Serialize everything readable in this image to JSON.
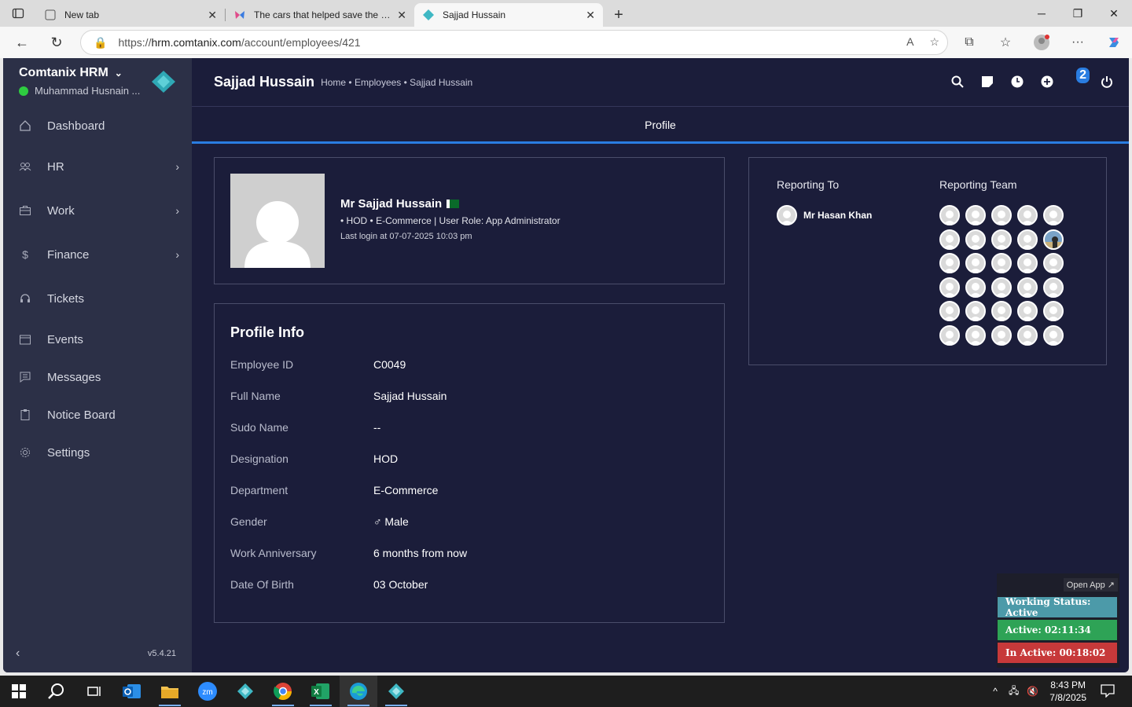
{
  "browser": {
    "tabs": [
      {
        "title": "New tab",
        "active": false
      },
      {
        "title": "The cars that helped save the con",
        "active": false
      },
      {
        "title": "Sajjad Hussain",
        "active": true
      }
    ],
    "url_prefix": "https://",
    "url_host": "hrm.comtanix.com",
    "url_path": "/account/employees/421"
  },
  "sidebar": {
    "brand": "Comtanix HRM",
    "user": "Muhammad Husnain ...",
    "items": [
      {
        "label": "Dashboard",
        "icon": "home-icon",
        "chevron": false
      },
      {
        "label": "HR",
        "icon": "users-icon",
        "chevron": true
      },
      {
        "label": "Work",
        "icon": "briefcase-icon",
        "chevron": true
      },
      {
        "label": "Finance",
        "icon": "dollar-icon",
        "chevron": true
      },
      {
        "label": "Tickets",
        "icon": "headset-icon",
        "chevron": false
      },
      {
        "label": "Events",
        "icon": "calendar-icon",
        "chevron": false
      },
      {
        "label": "Messages",
        "icon": "message-icon",
        "chevron": false
      },
      {
        "label": "Notice Board",
        "icon": "clipboard-icon",
        "chevron": false
      },
      {
        "label": "Settings",
        "icon": "gear-icon",
        "chevron": false
      }
    ],
    "version": "v5.4.21"
  },
  "header": {
    "title": "Sajjad Hussain",
    "breadcrumb": "Home • Employees • Sajjad Hussain",
    "notification_count": "2"
  },
  "tab": {
    "label": "Profile"
  },
  "profile": {
    "name": "Mr Sajjad Hussain",
    "meta": "• HOD • E-Commerce    | User Role: App Administrator",
    "last_login": "Last login at 07-07-2025 10:03 pm"
  },
  "info": {
    "title": "Profile Info",
    "rows": [
      {
        "key": "Employee ID",
        "value": "C0049"
      },
      {
        "key": "Full Name",
        "value": "Sajjad Hussain"
      },
      {
        "key": "Sudo Name",
        "value": "--"
      },
      {
        "key": "Designation",
        "value": "HOD"
      },
      {
        "key": "Department",
        "value": "E-Commerce"
      },
      {
        "key": "Gender",
        "value": "♂ Male"
      },
      {
        "key": "Work Anniversary",
        "value": "6 months from now"
      },
      {
        "key": "Date Of Birth",
        "value": "03 October"
      }
    ]
  },
  "reporting": {
    "to_title": "Reporting To",
    "team_title": "Reporting Team",
    "manager": "Mr Hasan Khan"
  },
  "status_widget": {
    "open_app": "Open App ↗",
    "working": "Working Status: Active",
    "active": "Active: 02:11:34",
    "inactive": "In Active: 00:18:02",
    "colors": {
      "working": "#4c9aa9",
      "active": "#2ea356",
      "inactive": "#c7393a"
    }
  },
  "taskbar": {
    "time": "8:43 PM",
    "date": "7/8/2025"
  }
}
